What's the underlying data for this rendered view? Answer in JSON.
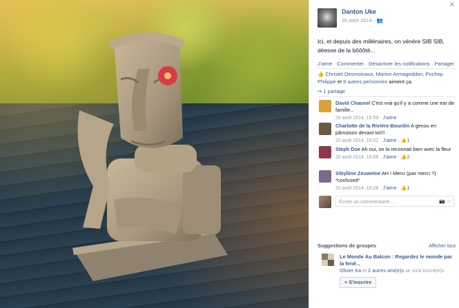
{
  "post": {
    "author": "Danton Uke",
    "date": "20 août 2014 · ",
    "audience_icon": "friends-icon",
    "text": "Ici, et depuis des millénaires, on vénère SIB SIB, déesse de la bôôôté...",
    "actions": {
      "like": "J'aime",
      "sep1": " · ",
      "comment": "Commenter",
      "sep2": " · ",
      "notifications": "Désactiver les notifications",
      "sep3": " · ",
      "share": "Partager"
    },
    "likes": {
      "names": "Christel Desmoinaux, Marion Armageddon, Pochep Philippe",
      "and": " et ",
      "others": "9 autres personnes",
      "suffix": " aiment ça."
    },
    "shares": "1 partage"
  },
  "comments": [
    {
      "author": "David Chauvel",
      "text": " C'est vrai qu'il y a comme une ear de famille...",
      "time": "20 août 2014, 15:59",
      "like": "J'aime",
      "likes": "",
      "avatar_color": "#d8a23a"
    },
    {
      "author": "Charlotte de la Rivière-Bourdin",
      "text": " A genou en pâmoison devant toi!!!",
      "time": "20 août 2014, 16:02",
      "like": "J'aime",
      "likes": "1",
      "avatar_color": "#6a5a44"
    },
    {
      "author": "Steph Doe",
      "text": " Ah oui, on la reconnait bien avec la fleur",
      "time": "20 août 2014, 16:08",
      "like": "J'aime",
      "likes": "2",
      "avatar_color": "#8a3a4a"
    },
    {
      "author": "Sibylline Zeuwelne",
      "text": " AH ! Merci (pas merci ?) *confused*",
      "time": "20 août 2014, 16:28",
      "like": "J'aime",
      "likes": "1",
      "avatar_color": "#7a6a8a"
    }
  ],
  "write_comment": {
    "placeholder": "Écrire un commentaire..."
  },
  "suggestions": {
    "title": "Suggestions de groupes",
    "see_all": "Afficher tout",
    "group": {
      "name": "Le Monde Au Balcon : Regardez le monde par la fenê...",
      "friend": "Olivier Ka",
      "and": " et ",
      "others": "2 autres ami(e)s",
      "suffix": " se sont inscrit(e)s",
      "join": "+ S'inscrire"
    }
  },
  "colors": {
    "link": "#3b5998",
    "meta": "#9197a3"
  }
}
